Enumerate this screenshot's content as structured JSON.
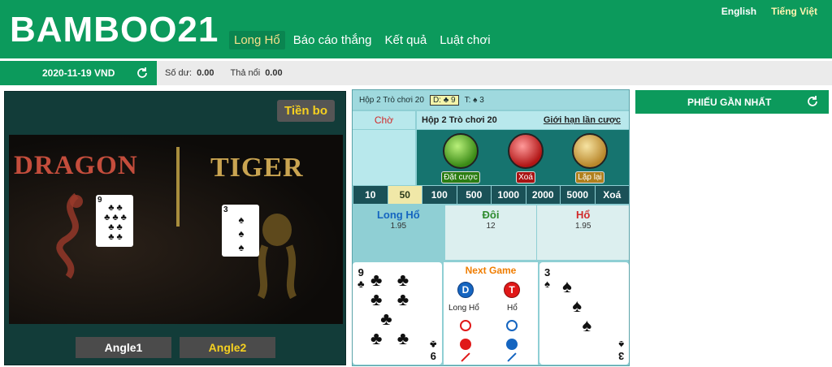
{
  "header": {
    "logo": "BAMBOO21",
    "nav": [
      {
        "label": "Long Hổ",
        "active": true
      },
      {
        "label": "Báo cáo thắng",
        "active": false
      },
      {
        "label": "Kết quả",
        "active": false
      },
      {
        "label": "Luật chơi",
        "active": false
      }
    ],
    "languages": [
      "English",
      "Tiếng Việt"
    ]
  },
  "subbar": {
    "date_currency": "2020-11-19 VND",
    "balance_label": "Số dư:",
    "balance_value": "0.00",
    "float_label": "Thả nổi",
    "float_value": "0.00",
    "refresh_icon": "refresh-icon"
  },
  "video": {
    "tip_button": "Tiền bo",
    "dragon_text": "DRAGON",
    "tiger_text": "TIGER",
    "dragon_card": {
      "rank": "9",
      "suit": "♣"
    },
    "tiger_card": {
      "rank": "3",
      "suit": "♠"
    },
    "angle1": "Angle1",
    "angle2": "Angle2"
  },
  "panel": {
    "shoe_game": "Hộp 2 Trò chơi 20",
    "dragon_result": "D: ♣ 9",
    "tiger_result": "T: ♠ 3",
    "status": "Chờ",
    "game_label": "Hộp 2  Trò chơi 20",
    "limit_link": "Giới hạn lần cược",
    "buttons": {
      "place": "Đặt cược",
      "clear": "Xoá",
      "repeat": "Lặp lại"
    },
    "chips": [
      "10",
      "50",
      "100",
      "500",
      "1000",
      "2000",
      "5000",
      "Xoá"
    ],
    "selected_chip": "50",
    "bets": [
      {
        "name": "Long Hổ",
        "odds": "1.95",
        "color": "#1565c0"
      },
      {
        "name": "Đôi",
        "odds": "12",
        "color": "#2e8b2e"
      },
      {
        "name": "Hổ",
        "odds": "1.95",
        "color": "#d12a2a"
      }
    ],
    "left_card": {
      "rank": "9",
      "suit": "♣"
    },
    "right_card": {
      "rank": "3",
      "suit": "♠"
    },
    "next_game": {
      "title": "Next Game",
      "dragon_badge": "D",
      "tiger_badge": "T",
      "dragon_label": "Long Hổ",
      "tiger_label": "Hổ",
      "dragon_color": "#1565c0",
      "tiger_color": "#e01818"
    }
  },
  "right_panel": {
    "title": "PHIẾU GẦN NHẤT"
  },
  "colors": {
    "brand_green": "#0c9a5c",
    "panel_teal": "#8fcfd4",
    "chip_dark": "#1a5157"
  }
}
